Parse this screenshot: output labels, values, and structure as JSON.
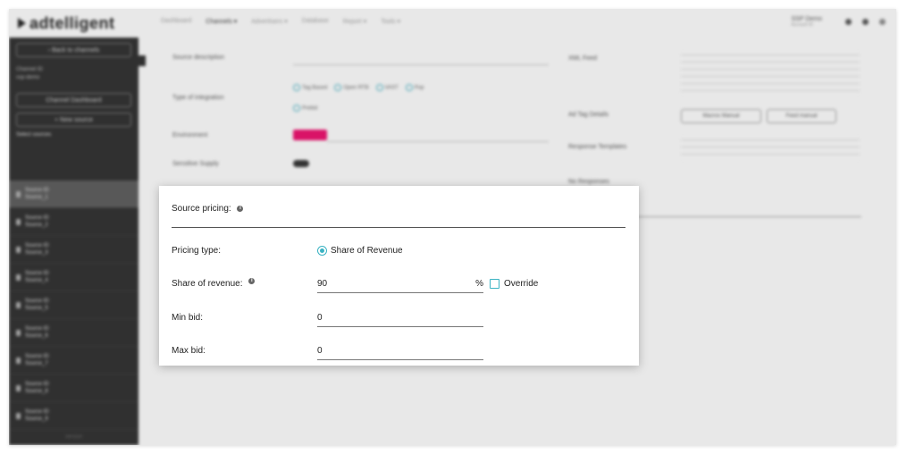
{
  "app": {
    "logo_text": "adtelligent",
    "nav": [
      "Dashboard",
      "Channels ▾",
      "Advertisers ▾",
      "Database",
      "Report ▾",
      "Tools ▾"
    ],
    "account": "SSP Demo",
    "account_sub": "Account ID"
  },
  "sidebar": {
    "back_button": "‹ Back to channels",
    "channel_label": "Channel ID",
    "channel_name": "ssp-demo",
    "dashboard_button": "Channel Dashboard",
    "new_source_button": "+ New source",
    "select_sources_label": "Select sources",
    "sources": [
      {
        "id": "Source ID",
        "name": "Source_1"
      },
      {
        "id": "Source ID",
        "name": "Source_2"
      },
      {
        "id": "Source ID",
        "name": "Source_3"
      },
      {
        "id": "Source ID",
        "name": "Source_4"
      },
      {
        "id": "Source ID",
        "name": "Source_5"
      },
      {
        "id": "Source ID",
        "name": "Source_6"
      },
      {
        "id": "Source ID",
        "name": "Source_7"
      },
      {
        "id": "Source ID",
        "name": "Source_8"
      },
      {
        "id": "Source ID",
        "name": "Source_9"
      }
    ],
    "footer": "version"
  },
  "background_form": {
    "source_description": "Source description",
    "type_of_integration": "Type of integration",
    "integration_options": [
      "Tag Based",
      "Open RTB",
      "VAST",
      "Pop"
    ],
    "integration_option_5": "Prebid",
    "environment": "Environment",
    "environment_value": "Desktop",
    "sensitive_supply": "Sensitive Supply",
    "xml_feed": "XML Feed",
    "ad_tag_details": "Ad Tag Details",
    "macros_manual": "Macros Manual",
    "feed_manual": "Feed manual",
    "response_templates": "Response Templates",
    "no_responses": "No Responses"
  },
  "modal": {
    "title": "Source pricing:",
    "pricing_type_label": "Pricing type:",
    "pricing_type_value": "Share of Revenue",
    "share_label": "Share of revenue:",
    "share_value": "90",
    "share_unit": "%",
    "override_label": "Override",
    "min_bid_label": "Min bid:",
    "min_bid_value": "0",
    "max_bid_label": "Max bid:",
    "max_bid_value": "0"
  },
  "colors": {
    "accent": "#3bb3c3",
    "sidebar": "#2f2f2f",
    "environment_tag": "#e3106a"
  }
}
